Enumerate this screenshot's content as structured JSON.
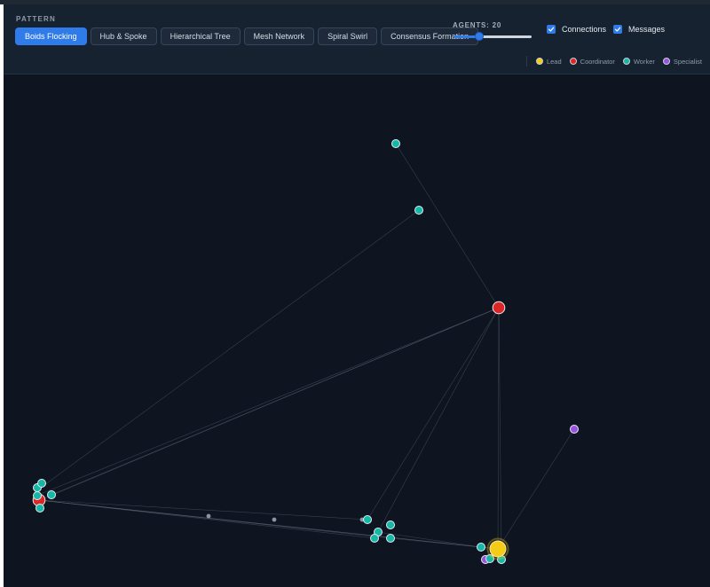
{
  "header": {
    "pattern_label": "PATTERN",
    "patterns": [
      {
        "label": "Boids Flocking",
        "active": true
      },
      {
        "label": "Hub & Spoke",
        "active": false
      },
      {
        "label": "Hierarchical Tree",
        "active": false
      },
      {
        "label": "Mesh Network",
        "active": false
      },
      {
        "label": "Spiral Swirl",
        "active": false
      },
      {
        "label": "Consensus Formation",
        "active": false
      }
    ],
    "agents_label": "AGENTS: 20",
    "agents_slider": {
      "value": 20,
      "min": 5,
      "max": 50
    },
    "show_connections": {
      "label": "Connections",
      "checked": true
    },
    "show_messages": {
      "label": "Messages",
      "checked": true
    }
  },
  "legend": [
    {
      "label": "Lead",
      "color": "#f5cc15"
    },
    {
      "label": "Coordinator",
      "color": "#dc2626"
    },
    {
      "label": "Worker",
      "color": "#14b8a6"
    },
    {
      "label": "Specialist",
      "color": "#9b51e0"
    }
  ],
  "colors": {
    "accent": "#2f7bea",
    "canvas_bg": "#0e1521",
    "edge": "#6b7686"
  },
  "icons": {
    "checkbox_checked": "check-icon"
  }
}
